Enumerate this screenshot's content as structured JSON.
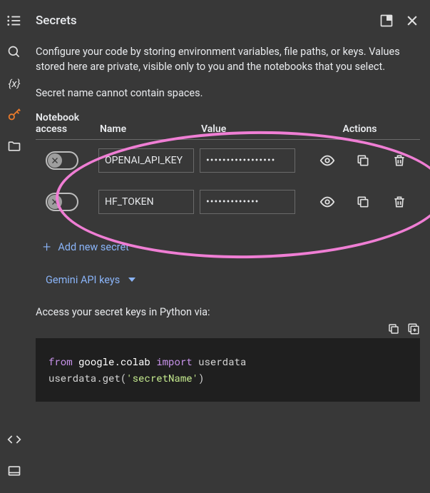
{
  "panel": {
    "title": "Secrets",
    "description": "Configure your code by storing environment variables, file paths, or keys. Values stored here are private, visible only to you and the notebooks that you select.",
    "warning": "Secret name cannot contain spaces.",
    "columns": {
      "access": "Notebook access",
      "name": "Name",
      "value": "Value",
      "actions": "Actions"
    },
    "secrets": [
      {
        "name": "OPENAI_API_KEY",
        "masked_value": "•••••••••••••••••",
        "access": false
      },
      {
        "name": "HF_TOKEN",
        "masked_value": "•••••••••••••",
        "access": false
      }
    ],
    "add_label": "Add new secret",
    "gemini_label": "Gemini API keys",
    "access_hint": "Access your secret keys in Python via:",
    "code": {
      "line1_kw1": "from",
      "line1_mod": "google.colab",
      "line1_kw2": "import",
      "line1_obj": "userdata",
      "line2_pre": "userdata.get(",
      "line2_str": "'secretName'",
      "line2_post": ")"
    }
  },
  "rail": {
    "items": [
      "toc-icon",
      "search-icon",
      "variables-icon",
      "key-icon",
      "folder-icon",
      "code-icon",
      "terminal-icon"
    ]
  }
}
